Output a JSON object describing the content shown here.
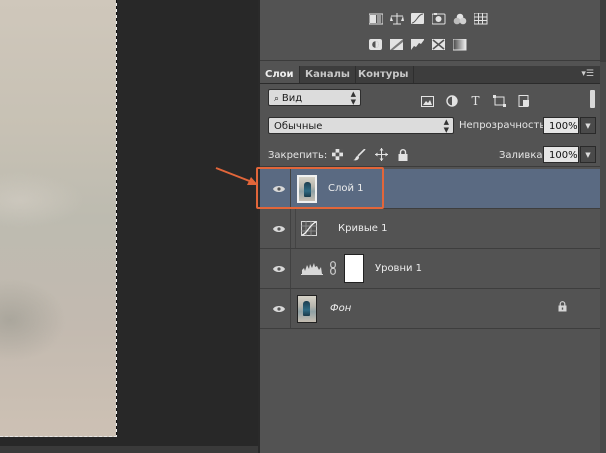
{
  "canvas": {
    "arrow_color": "#e2663a"
  },
  "adjustments": {
    "row1": [
      "brightness-contrast-icon",
      "levels-icon",
      "curves-icon",
      "exposure-icon",
      "vibrance-icon",
      "color-lookup-icon"
    ],
    "row2": [
      "invert-icon",
      "posterize-icon",
      "threshold-icon",
      "selective-color-icon",
      "gradient-map-icon"
    ]
  },
  "tabs": [
    {
      "label": "Слои",
      "active": true
    },
    {
      "label": "Каналы",
      "active": false
    },
    {
      "label": "Контуры",
      "active": false
    }
  ],
  "panel_menu_icon": "panel-menu-icon",
  "filter": {
    "kind_value": "Вид",
    "search_icon": "search-icon",
    "icons": [
      "image-filter-icon",
      "adjustment-filter-icon",
      "type-filter-icon",
      "shape-filter-icon",
      "smart-object-filter-icon"
    ]
  },
  "blend": {
    "mode_value": "Обычные",
    "opacity_label": "Непрозрачность:",
    "opacity_value": "100%"
  },
  "lock": {
    "label": "Закрепить:",
    "icons": [
      "lock-transparent-icon",
      "lock-image-icon",
      "lock-position-icon",
      "lock-all-icon"
    ],
    "fill_label": "Заливка:",
    "fill_value": "100%"
  },
  "layers": [
    {
      "name": "Слой 1",
      "type": "pixel",
      "selected": true,
      "visible": true
    },
    {
      "name": "Кривые 1",
      "type": "curves",
      "selected": false,
      "visible": true
    },
    {
      "name": "Уровни 1",
      "type": "levels",
      "selected": false,
      "visible": true
    },
    {
      "name": "Фон",
      "type": "background",
      "selected": false,
      "visible": true,
      "locked": true
    }
  ],
  "accent": "#e2663a",
  "selection_color": "#5a6a82"
}
